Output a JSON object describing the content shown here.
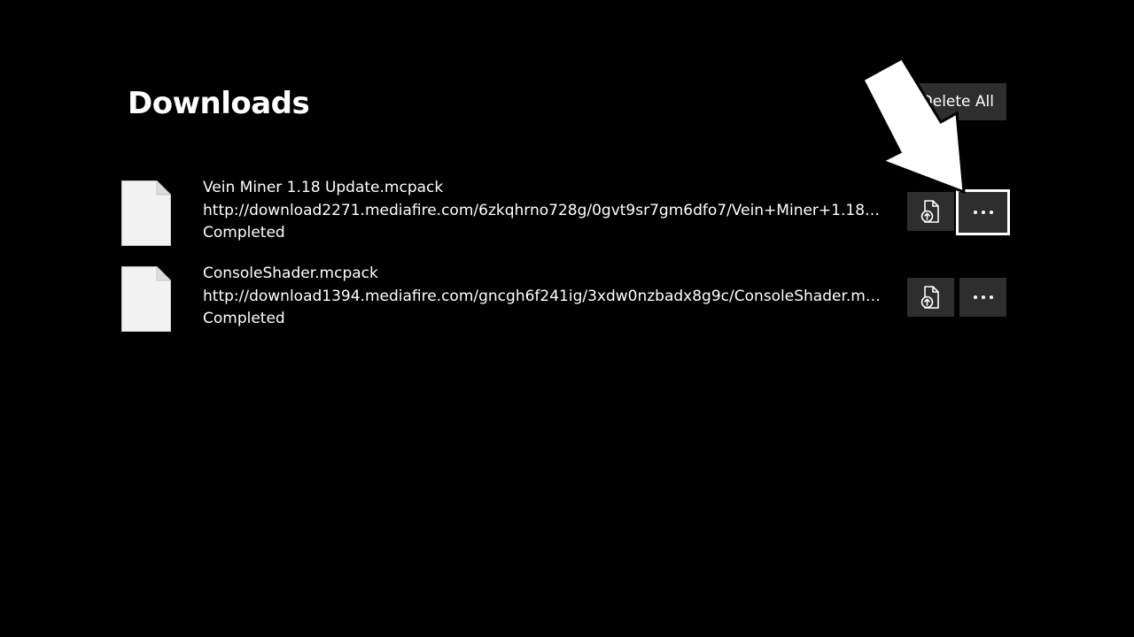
{
  "page": {
    "title": "Downloads",
    "delete_all_label": "Delete All"
  },
  "downloads": [
    {
      "filename": "Vein Miner 1.18 Update.mcpack",
      "url": "http://download2271.mediafire.com/6zkqhrno728g/0gvt9sr7gm6dfo7/Vein+Miner+1.18+U...",
      "status": "Completed",
      "focused_action": "more"
    },
    {
      "filename": "ConsoleShader.mcpack",
      "url": "http://download1394.mediafire.com/gncgh6f241ig/3xdw0nzbadx8g9c/ConsoleShader.mcpa...",
      "status": "Completed",
      "focused_action": ""
    }
  ],
  "icons": {
    "file": "file-icon",
    "open": "open-file-icon",
    "more": "more-options-icon",
    "pointer": "pointer-arrow-icon"
  },
  "colors": {
    "background": "#000000",
    "button": "#2e2e2e",
    "text": "#ffffff",
    "focus_border": "#ffffff"
  }
}
